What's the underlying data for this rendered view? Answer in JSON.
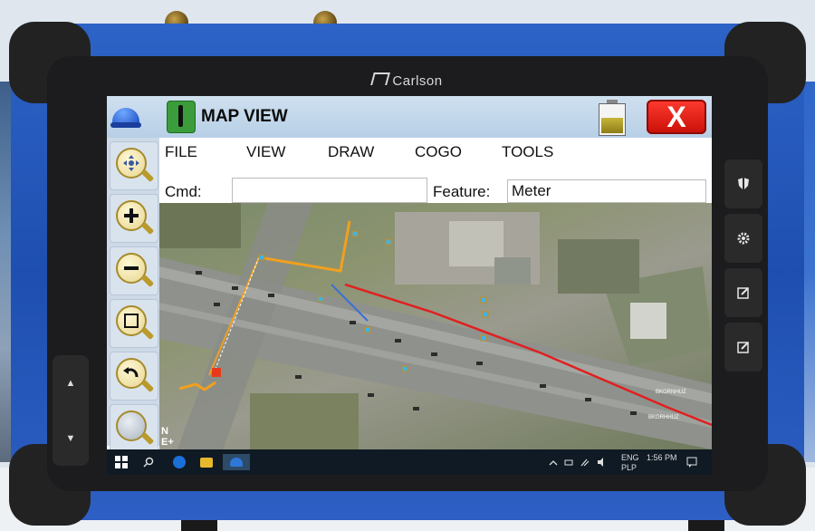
{
  "device": {
    "brand": "Carlson",
    "side_buttons": [
      "shield-icon",
      "gear-icon",
      "edit-icon",
      "edit-icon"
    ],
    "left_buttons": [
      "▲",
      "▼"
    ]
  },
  "app": {
    "title": "MAP VIEW",
    "close_label": "X",
    "battery_level": 0.55
  },
  "menu": {
    "items": [
      "FILE",
      "VIEW",
      "DRAW",
      "COGO",
      "TOOLS"
    ]
  },
  "cmdbar": {
    "cmd_label": "Cmd:",
    "cmd_value": "",
    "feature_label": "Feature:",
    "feature_value": "Meter"
  },
  "toolbox": {
    "tools": [
      "pan-icon",
      "zoom-in-icon",
      "zoom-out-icon",
      "zoom-window-icon",
      "zoom-previous-icon",
      "zoom-extents-icon"
    ]
  },
  "map": {
    "north_label": "N\nE+"
  },
  "taskbar": {
    "lang_top": "ENG",
    "lang_bottom": "PLP",
    "time": "1:56 PM"
  }
}
